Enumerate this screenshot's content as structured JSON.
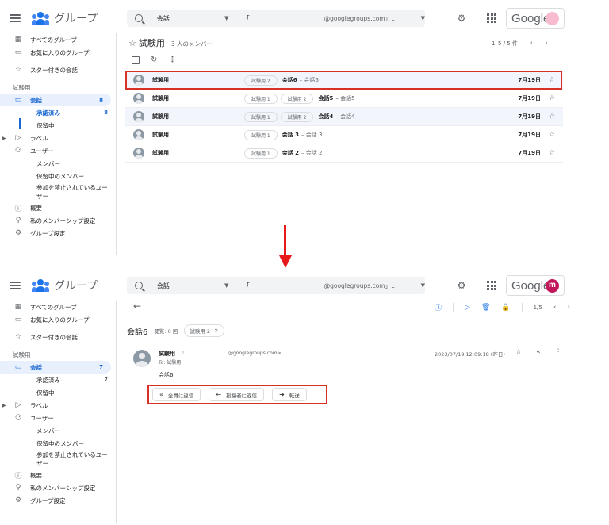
{
  "sidebar": {
    "app_title": "グループ",
    "all_groups": "すべてのグループ",
    "favorite_groups": "お気に入りのグループ",
    "starred": "スター付きの会話",
    "group_section": "試験用",
    "conversations": "会話",
    "approved": "承認済み",
    "pending": "保留中",
    "labels": "ラベル",
    "users": "ユーザー",
    "members": "メンバー",
    "pending_members": "保留中のメンバー",
    "banned_users": "参加を禁止されているユーザー",
    "about": "概要",
    "my_membership": "私のメンバーシップ設定",
    "group_settings": "グループ設定"
  },
  "top": {
    "counts": {
      "conversations": "8",
      "approved": "8"
    },
    "group_name": "試験用",
    "member_count": "3 人のメンバー",
    "paging": "1–5 / 5 件",
    "rows": [
      {
        "sender": "試験用",
        "tag": "試験用 2",
        "subject": "会話6",
        "snippet": "– 会話6",
        "date": "7月19日"
      },
      {
        "sender": "試験用",
        "tag": "試験用 1",
        "subject": "会話5",
        "snippet": "– 会話5",
        "date": "7月19日"
      },
      {
        "sender": "試験用",
        "tag": "試験用 1",
        "subject": "会話4",
        "snippet": "– 会話4",
        "date": "7月19日"
      },
      {
        "sender": "試験用",
        "tag": "試験用 1",
        "subject": "会話 3",
        "snippet": "– 会話 3",
        "date": "7月19日"
      },
      {
        "sender": "試験用",
        "tag": "試験用 1",
        "subject": "会話 2",
        "snippet": "– 会話 2",
        "date": "7月19日"
      }
    ]
  },
  "search": {
    "query": "会話",
    "bracket": "「",
    "domain": "@googlegroups.com」…"
  },
  "brand": {
    "google": "Google",
    "avatar_letter": "m",
    "accent": "#1a73e8",
    "highlight": "#d93025"
  },
  "bottom": {
    "counts": {
      "conversations": "7",
      "approved": "7"
    },
    "paging": "1/5",
    "conv_title": "会話6",
    "views": "閲覧: 0 回",
    "conv_tag": "試験用 2",
    "from": "試験用",
    "from_email": "@googlegroups.com>",
    "to": "To: 試験用",
    "body": "会話6",
    "date": "2023/07/19 12:09:18 (昨日)",
    "reply_all": "全員に返信",
    "reply_author": "投稿者に返信",
    "forward": "転送"
  }
}
